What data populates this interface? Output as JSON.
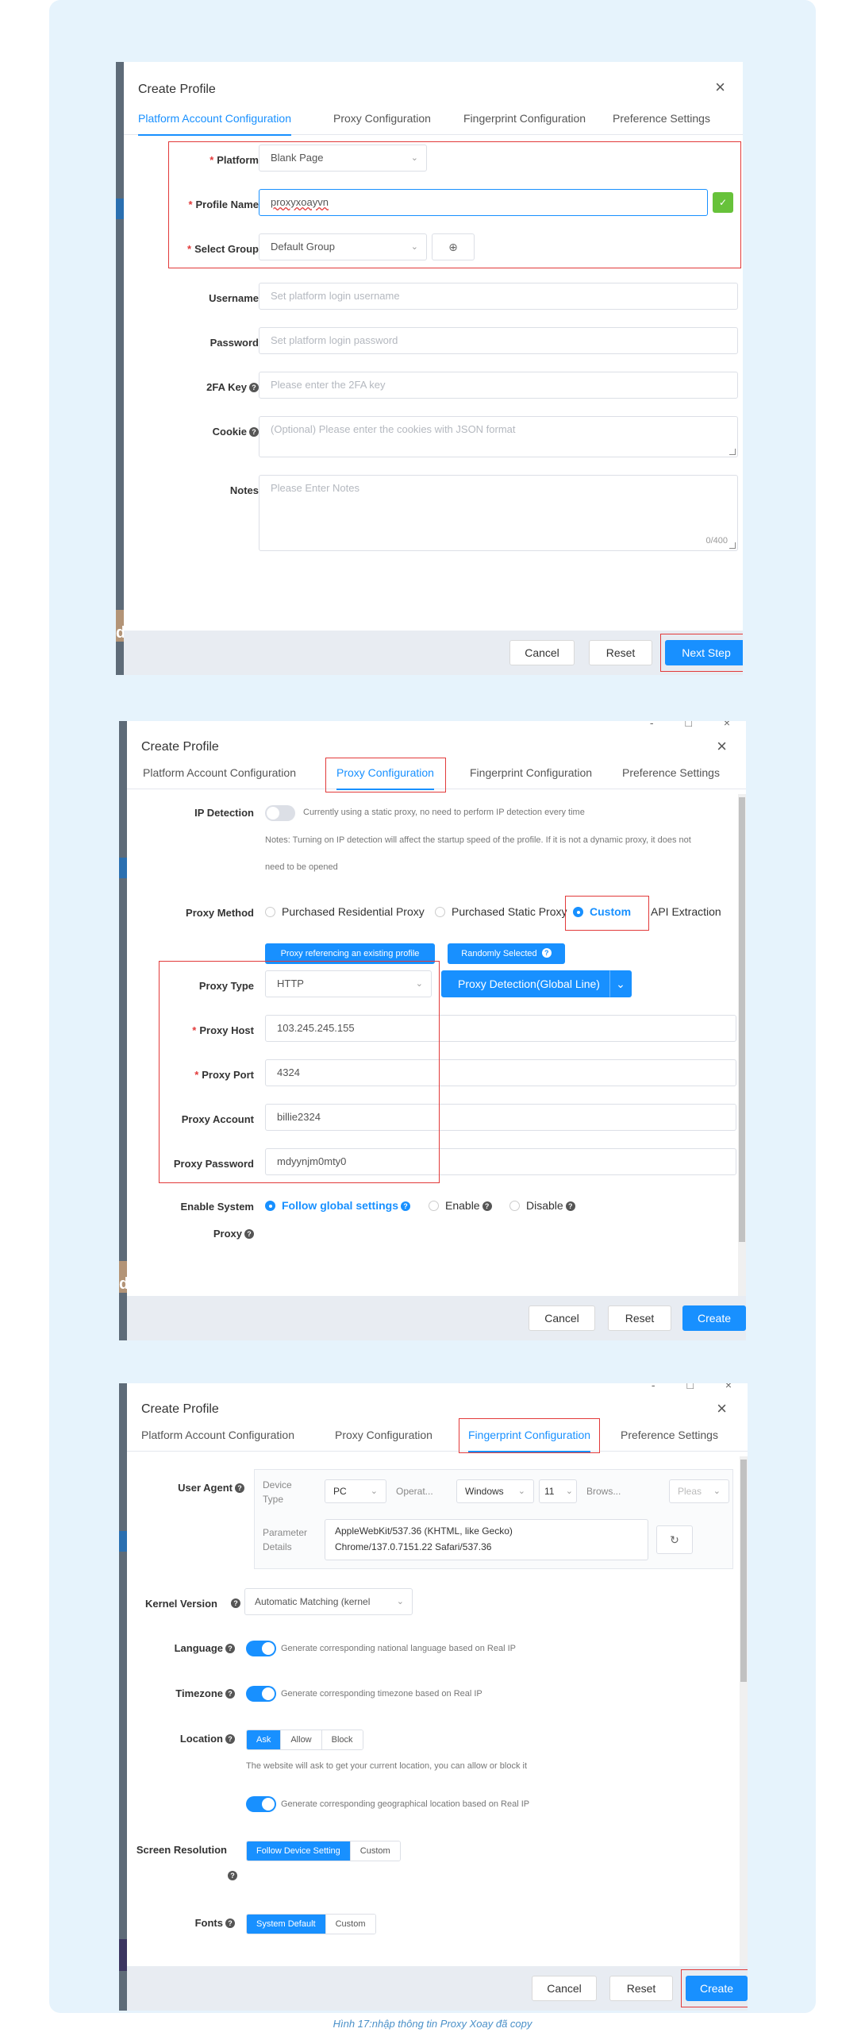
{
  "caption": "Hình 17:nhập thông tin Proxy Xoay đã copy",
  "dialog_title": "Create Profile",
  "tabs": [
    "Platform Account Configuration",
    "Proxy Configuration",
    "Fingerprint Configuration",
    "Preference Settings"
  ],
  "panel1": {
    "platform_label": "Platform",
    "platform_value": "Blank Page",
    "profile_name_label": "Profile Name",
    "profile_name_value": "proxyxoayvn",
    "select_group_label": "Select Group",
    "select_group_value": "Default Group",
    "username_label": "Username",
    "username_placeholder": "Set platform login username",
    "password_label": "Password",
    "password_placeholder": "Set platform login password",
    "twofa_label": "2FA Key",
    "twofa_placeholder": "Please enter the 2FA key",
    "cookie_label": "Cookie",
    "cookie_placeholder": "(Optional) Please enter the cookies with JSON format",
    "notes_label": "Notes",
    "notes_placeholder": "Please Enter Notes",
    "notes_counter": "0/400",
    "cancel": "Cancel",
    "reset": "Reset",
    "next": "Next Step"
  },
  "panel2": {
    "ip_detection_label": "IP Detection",
    "ip_detection_text": "Currently using a static proxy, no need to perform IP detection every time",
    "ip_note_1": "Notes: Turning on IP detection will affect the startup speed of the profile. If it is not a dynamic proxy, it does not",
    "ip_note_2": "need to be opened",
    "proxy_method_label": "Proxy Method",
    "methods": [
      "Purchased Residential Proxy",
      "Purchased Static Proxy",
      "Custom",
      "API Extraction"
    ],
    "ref_btn": "Proxy referencing an existing profile",
    "random_btn": "Randomly Selected",
    "proxy_type_label": "Proxy Type",
    "proxy_type_value": "HTTP",
    "detect_btn": "Proxy Detection(Global Line)",
    "proxy_host_label": "Proxy Host",
    "proxy_host_value": "103.245.245.155",
    "proxy_port_label": "Proxy Port",
    "proxy_port_value": "4324",
    "proxy_account_label": "Proxy Account",
    "proxy_account_value": "billie2324",
    "proxy_password_label": "Proxy Password",
    "proxy_password_value": "mdyynjm0mty0",
    "system_proxy_label_1": "Enable System",
    "system_proxy_label_2": "Proxy",
    "system_opts": [
      "Follow global settings",
      "Enable",
      "Disable"
    ],
    "cancel": "Cancel",
    "reset": "Reset",
    "create": "Create"
  },
  "panel3": {
    "ua_label": "User Agent",
    "device_type_label_1": "Device",
    "device_type_label_2": "Type",
    "device_type_value": "PC",
    "os_label": "Operat...",
    "os_value": "Windows",
    "os_version": "11",
    "browser_label": "Brows...",
    "browser_placeholder": "Pleas",
    "param_label_1": "Parameter",
    "param_label_2": "Details",
    "param_line_1": "AppleWebKit/537.36 (KHTML, like Gecko)",
    "param_line_2": "Chrome/137.0.7151.22 Safari/537.36",
    "kernel_label": "Kernel Version",
    "kernel_value": "Automatic Matching (kernel",
    "language_label": "Language",
    "language_text": "Generate corresponding national language based on Real IP",
    "timezone_label": "Timezone",
    "timezone_text": "Generate corresponding timezone based on Real IP",
    "location_label": "Location",
    "location_opts": [
      "Ask",
      "Allow",
      "Block"
    ],
    "location_note": "The website will ask to get your current location, you can allow or block it",
    "geo_text": "Generate corresponding geographical location based on Real IP",
    "resolution_label": "Screen Resolution",
    "resolution_opts": [
      "Follow Device Setting",
      "Custom"
    ],
    "fonts_label": "Fonts",
    "fonts_opts": [
      "System Default",
      "Custom"
    ],
    "cancel": "Cancel",
    "reset": "Reset",
    "create": "Create"
  }
}
